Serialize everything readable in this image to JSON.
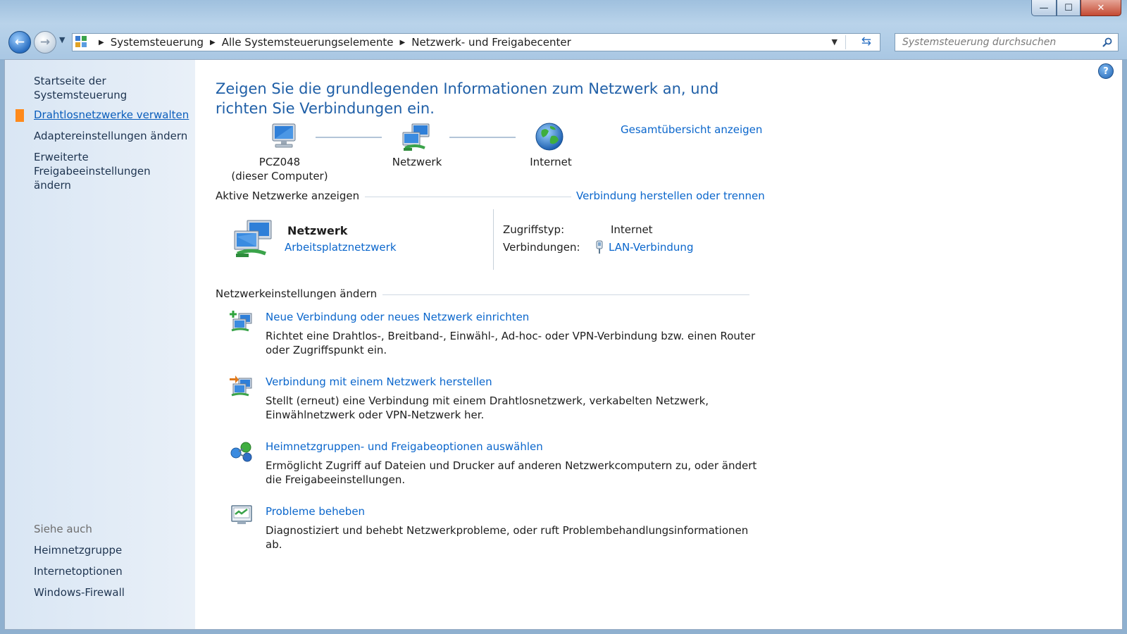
{
  "window": {
    "btn_min": "—",
    "btn_max": "☐",
    "btn_close": "✕"
  },
  "address": {
    "crumbs": [
      "Systemsteuerung",
      "Alle Systemsteuerungselemente",
      "Netzwerk- und Freigabecenter"
    ]
  },
  "search": {
    "placeholder": "Systemsteuerung durchsuchen"
  },
  "sidebar": {
    "home": "Startseite der Systemsteuerung",
    "items": [
      "Drahtlosnetzwerke verwalten",
      "Adaptereinstellungen ändern",
      "Erweiterte Freigabeeinstellungen ändern"
    ],
    "see_also_heading": "Siehe auch",
    "see_also": [
      "Heimnetzgruppe",
      "Internetoptionen",
      "Windows-Firewall"
    ]
  },
  "main": {
    "title": "Zeigen Sie die grundlegenden Informationen zum Netzwerk an, und richten Sie Verbindungen ein.",
    "full_map_link": "Gesamtübersicht anzeigen",
    "map": {
      "computer_name": "PCZ048",
      "computer_sub": "(dieser Computer)",
      "network": "Netzwerk",
      "internet": "Internet"
    },
    "active_heading": "Aktive Netzwerke anzeigen",
    "connect_link": "Verbindung herstellen oder trennen",
    "active": {
      "name": "Netzwerk",
      "type_link": "Arbeitsplatznetzwerk",
      "access_label": "Zugriffstyp:",
      "access_value": "Internet",
      "connections_label": "Verbindungen:",
      "connection_link": "LAN-Verbindung"
    },
    "settings_heading": "Netzwerkeinstellungen ändern",
    "tasks": [
      {
        "title": "Neue Verbindung oder neues Netzwerk einrichten",
        "desc": "Richtet eine Drahtlos-, Breitband-, Einwähl-, Ad-hoc- oder VPN-Verbindung bzw. einen Router oder Zugriffspunkt ein."
      },
      {
        "title": "Verbindung mit einem Netzwerk herstellen",
        "desc": "Stellt (erneut) eine Verbindung mit einem Drahtlosnetzwerk, verkabelten Netzwerk, Einwählnetzwerk oder VPN-Netzwerk her."
      },
      {
        "title": "Heimnetzgruppen- und Freigabeoptionen auswählen",
        "desc": "Ermöglicht Zugriff auf Dateien und Drucker auf anderen Netzwerkcomputern zu, oder ändert die Freigabeeinstellungen."
      },
      {
        "title": "Probleme beheben",
        "desc": "Diagnostiziert und behebt Netzwerkprobleme, oder ruft Problembehandlungsinformationen ab."
      }
    ]
  },
  "colors": {
    "link": "#0a66cc",
    "title": "#1f5fa7",
    "sidebar_marker": "#ff8a1c"
  }
}
